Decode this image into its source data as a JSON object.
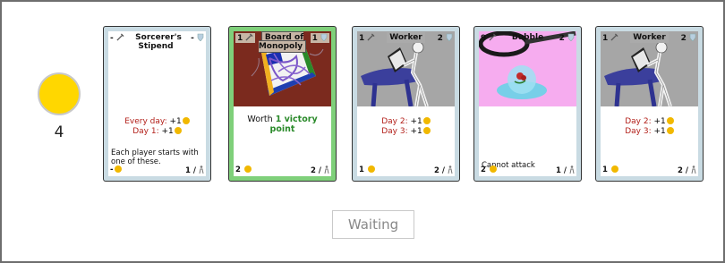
{
  "player": {
    "coins": "4",
    "coin_color": "#ffd700"
  },
  "status_button": {
    "label": "Waiting"
  },
  "cards": [
    {
      "name": "Sorcerer's Stipend",
      "attack": "-",
      "defense": "-",
      "effects": [
        {
          "label": "Every day:",
          "value": " +1"
        },
        {
          "label": "Day 1:",
          "value": " +1"
        }
      ],
      "description": "Each player starts with one of these.",
      "cost": "-",
      "quantity": "1 /"
    },
    {
      "name": "Board of Monopoly",
      "attack": "1",
      "defense": "1",
      "worth_prefix": "Worth ",
      "worth_value": "1 victory point",
      "cost": "2",
      "quantity": "2 /"
    },
    {
      "name": "Worker",
      "attack": "1",
      "defense": "2",
      "effects": [
        {
          "label": "Day 2:",
          "value": " +1"
        },
        {
          "label": "Day 3:",
          "value": " +1"
        }
      ],
      "cost": "1",
      "quantity": "2 /"
    },
    {
      "name": "Bubble",
      "attack": "9",
      "defense": "2",
      "description": "Cannot attack",
      "cost": "2",
      "quantity": "1 /"
    },
    {
      "name": "Worker",
      "attack": "1",
      "defense": "2",
      "effects": [
        {
          "label": "Day 2:",
          "value": " +1"
        },
        {
          "label": "Day 3:",
          "value": " +1"
        }
      ],
      "cost": "1",
      "quantity": "2 /"
    }
  ]
}
